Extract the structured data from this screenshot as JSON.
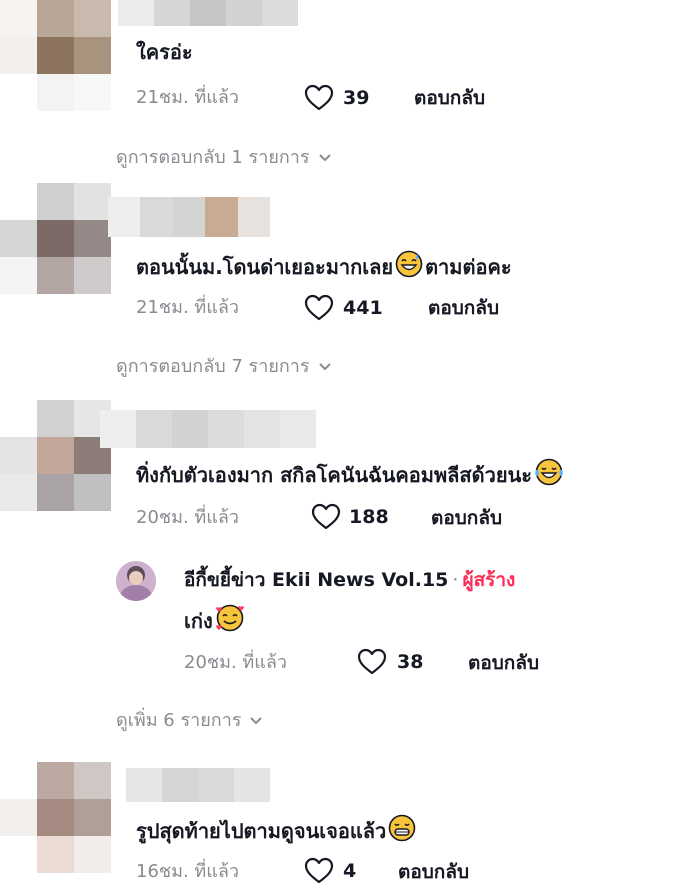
{
  "comments": [
    {
      "text": "ใครอ่ะ",
      "time": "21ชม. ที่แล้ว",
      "likes": "39",
      "reply_label": "ตอบกลับ",
      "view_replies": "ดูการตอบกลับ 1 รายการ"
    },
    {
      "text": "ตอนนั้นม.โดนด่าเยอะมากเลย",
      "text_after": "ตามต่อคะ",
      "time": "21ชม. ที่แล้ว",
      "likes": "441",
      "reply_label": "ตอบกลับ",
      "view_replies": "ดูการตอบกลับ 7 รายการ"
    },
    {
      "text": "ทิ่งกับตัวเองมาก สกิลโคนันฉันคอมพลีสด้วยนะ",
      "time": "20ชม. ที่แล้ว",
      "likes": "188",
      "reply_label": "ตอบกลับ",
      "creator_reply": {
        "name": "อีกี้ขยี้ข่าว Ekii News Vol.15",
        "separator": "·",
        "tag": "ผู้สร้าง",
        "text": "เก่ง",
        "time": "20ชม. ที่แล้ว",
        "likes": "38",
        "reply_label": "ตอบกลับ"
      },
      "view_more": "ดูเพิ่ม 6 รายการ"
    },
    {
      "text": "รูปสุดท้ายไปตามดูจนเจอแล้ว",
      "time": "16ชม. ที่แล้ว",
      "likes": "4",
      "reply_label": "ตอบกลับ"
    }
  ],
  "icons": {
    "like": "heart-outline-icon",
    "expand": "chevron-down-icon",
    "emoji_sweat": "grinning-sweat-emoji",
    "emoji_tears": "tears-of-joy-emoji",
    "emoji_hearts": "smiling-hearts-emoji",
    "emoji_grin": "grinning-emoji"
  },
  "colors": {
    "text": "#161823",
    "muted": "#8a8b91",
    "creator_tag": "#fe2c55"
  }
}
